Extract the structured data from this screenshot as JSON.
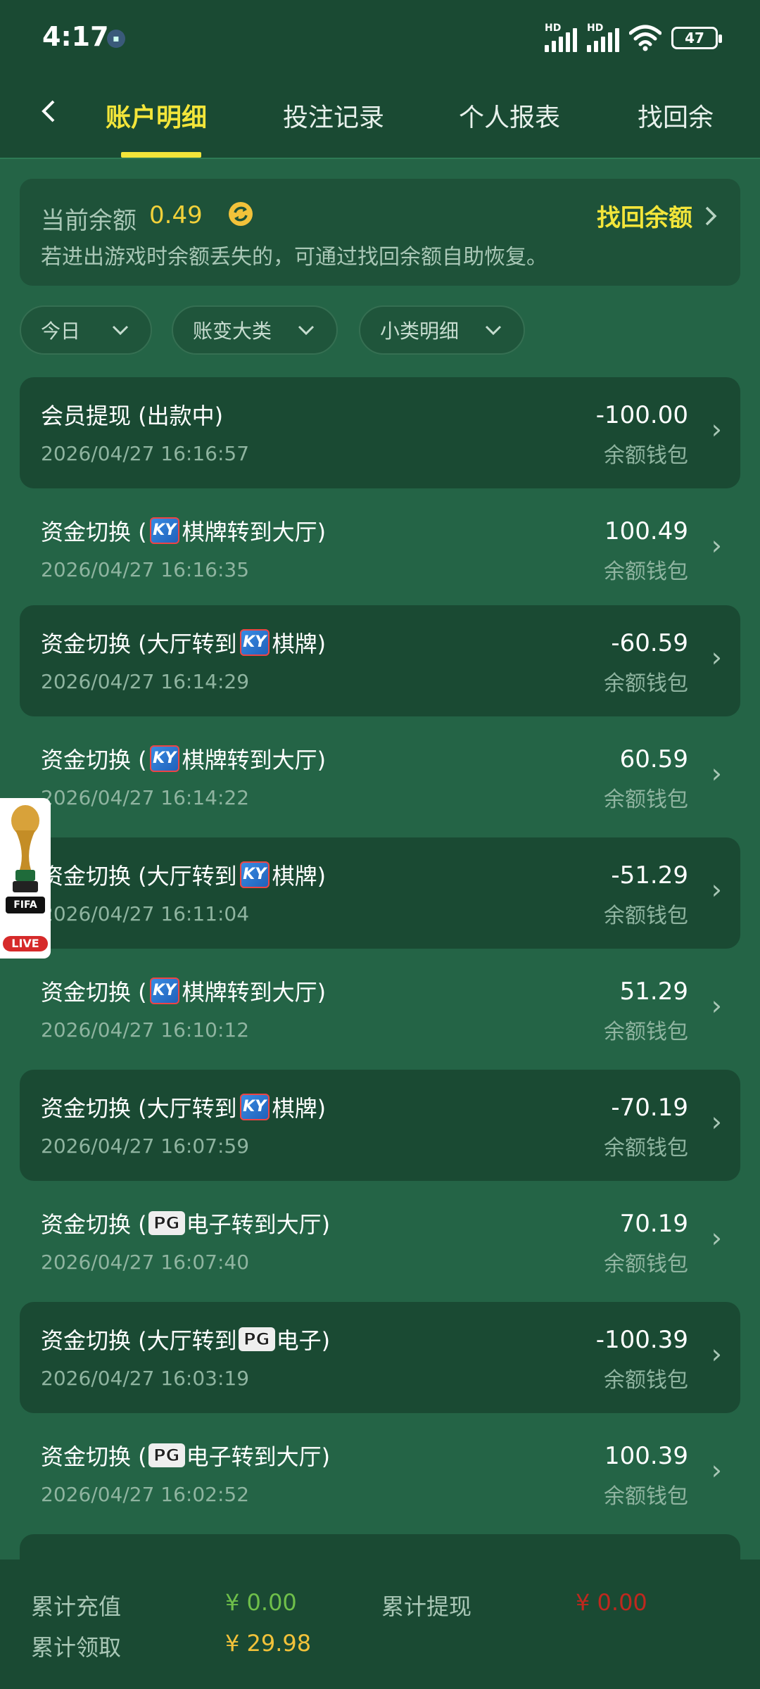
{
  "status_bar": {
    "time": "4:17",
    "battery": "47",
    "signal_label": "HD"
  },
  "nav": {
    "back_icon": "chevron-left-icon",
    "tabs": [
      {
        "label": "账户明细",
        "active": true
      },
      {
        "label": "投注记录",
        "active": false
      },
      {
        "label": "个人报表",
        "active": false
      },
      {
        "label": "找回余",
        "active": false
      }
    ]
  },
  "balance": {
    "label": "当前余额",
    "value": "0.49",
    "recover_label": "找回余额",
    "hint": "若进出游戏时余额丢失的，可通过找回余额自助恢复。"
  },
  "filters": [
    {
      "label": "今日"
    },
    {
      "label": "账变大类"
    },
    {
      "label": "小类明细"
    }
  ],
  "transactions": [
    {
      "title": "会员提现 (出款中)",
      "time": "2026/04/27 16:16:57",
      "amount": "-100.00",
      "wallet": "余额钱包"
    },
    {
      "title_prefix": "资金切换 (",
      "badge": "KY",
      "title_suffix": "棋牌转到大厅)",
      "time": "2026/04/27 16:16:35",
      "amount": "100.49",
      "wallet": "余额钱包"
    },
    {
      "title_prefix": "资金切换 (大厅转到",
      "badge": "KY",
      "title_suffix": "棋牌)",
      "time": "2026/04/27 16:14:29",
      "amount": "-60.59",
      "wallet": "余额钱包"
    },
    {
      "title_prefix": "资金切换 (",
      "badge": "KY",
      "title_suffix": "棋牌转到大厅)",
      "time": "2026/04/27 16:14:22",
      "amount": "60.59",
      "wallet": "余额钱包"
    },
    {
      "title_prefix": "资金切换 (大厅转到",
      "badge": "KY",
      "title_suffix": "棋牌)",
      "time": "2026/04/27 16:11:04",
      "amount": "-51.29",
      "wallet": "余额钱包"
    },
    {
      "title_prefix": "资金切换 (",
      "badge": "KY",
      "title_suffix": "棋牌转到大厅)",
      "time": "2026/04/27 16:10:12",
      "amount": "51.29",
      "wallet": "余额钱包"
    },
    {
      "title_prefix": "资金切换 (大厅转到",
      "badge": "KY",
      "title_suffix": "棋牌)",
      "time": "2026/04/27 16:07:59",
      "amount": "-70.19",
      "wallet": "余额钱包"
    },
    {
      "title_prefix": "资金切换 (",
      "badge": "PG",
      "title_suffix": "电子转到大厅)",
      "time": "2026/04/27 16:07:40",
      "amount": "70.19",
      "wallet": "余额钱包"
    },
    {
      "title_prefix": "资金切换 (大厅转到",
      "badge": "PG",
      "title_suffix": "电子)",
      "time": "2026/04/27 16:03:19",
      "amount": "-100.39",
      "wallet": "余额钱包"
    },
    {
      "title_prefix": "资金切换 (",
      "badge": "PG",
      "title_suffix": "电子转到大厅)",
      "time": "2026/04/27 16:02:52",
      "amount": "100.39",
      "wallet": "余额钱包"
    }
  ],
  "floating_badge": {
    "fifa": "FIFA",
    "live": "LIVE"
  },
  "footer": {
    "total_recharge_label": "累计充值",
    "total_recharge_value": "¥ 0.00",
    "total_withdraw_label": "累计提现",
    "total_withdraw_value": "¥ 0.00",
    "total_claim_label": "累计领取",
    "total_claim_value": "¥ 29.98"
  },
  "colors": {
    "background": "#246446",
    "header": "#1a4a33",
    "accent_yellow": "#f3e53a",
    "green_value": "#6fbf4a",
    "red_value": "#c0281e",
    "gold_value": "#f2c23a"
  }
}
